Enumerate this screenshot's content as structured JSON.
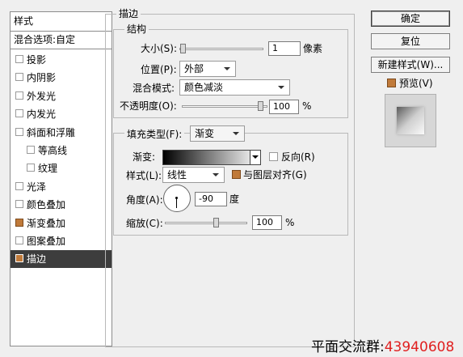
{
  "style_list": {
    "header": "样式",
    "blend_options": "混合选项:自定",
    "items": [
      {
        "label": "投影",
        "checked": false,
        "indent": false,
        "selected": false,
        "has_checkbox": true
      },
      {
        "label": "内阴影",
        "checked": false,
        "indent": false,
        "selected": false,
        "has_checkbox": true
      },
      {
        "label": "外发光",
        "checked": false,
        "indent": false,
        "selected": false,
        "has_checkbox": true
      },
      {
        "label": "内发光",
        "checked": false,
        "indent": false,
        "selected": false,
        "has_checkbox": true
      },
      {
        "label": "斜面和浮雕",
        "checked": false,
        "indent": false,
        "selected": false,
        "has_checkbox": true
      },
      {
        "label": "等高线",
        "checked": false,
        "indent": true,
        "selected": false,
        "has_checkbox": true
      },
      {
        "label": "纹理",
        "checked": false,
        "indent": true,
        "selected": false,
        "has_checkbox": true
      },
      {
        "label": "光泽",
        "checked": false,
        "indent": false,
        "selected": false,
        "has_checkbox": true
      },
      {
        "label": "颜色叠加",
        "checked": false,
        "indent": false,
        "selected": false,
        "has_checkbox": true
      },
      {
        "label": "渐变叠加",
        "checked": true,
        "indent": false,
        "selected": false,
        "has_checkbox": true
      },
      {
        "label": "图案叠加",
        "checked": false,
        "indent": false,
        "selected": false,
        "has_checkbox": true
      },
      {
        "label": "描边",
        "checked": true,
        "indent": false,
        "selected": true,
        "has_checkbox": true
      }
    ]
  },
  "stroke": {
    "title": "描边",
    "structure": {
      "title": "结构",
      "size_label": "大小(S):",
      "size_value": "1",
      "size_unit": "像素",
      "position_label": "位置(P):",
      "position_value": "外部",
      "blend_label": "混合模式:",
      "blend_value": "颜色减淡",
      "opacity_label": "不透明度(O):",
      "opacity_value": "100",
      "opacity_unit": "%"
    },
    "fill": {
      "fill_type_label": "填充类型(F):",
      "fill_type_value": "渐变",
      "gradient_label": "渐变:",
      "reverse_label": "反向(R)",
      "style_label": "样式(L):",
      "style_value": "线性",
      "align_label": "与图层对齐(G)",
      "angle_label": "角度(A):",
      "angle_value": "-90",
      "angle_unit": "度",
      "scale_label": "缩放(C):",
      "scale_value": "100",
      "scale_unit": "%"
    }
  },
  "buttons": {
    "ok": "确定",
    "reset": "复位",
    "new_style": "新建样式(W)...",
    "preview": "预览(V)"
  },
  "footer": {
    "label": "平面交流群:",
    "number": "43940608"
  },
  "colors": {
    "accent_checkbox": "#c07a3a",
    "selected_row": "#3d3d3d",
    "footer_number": "#e02020"
  }
}
